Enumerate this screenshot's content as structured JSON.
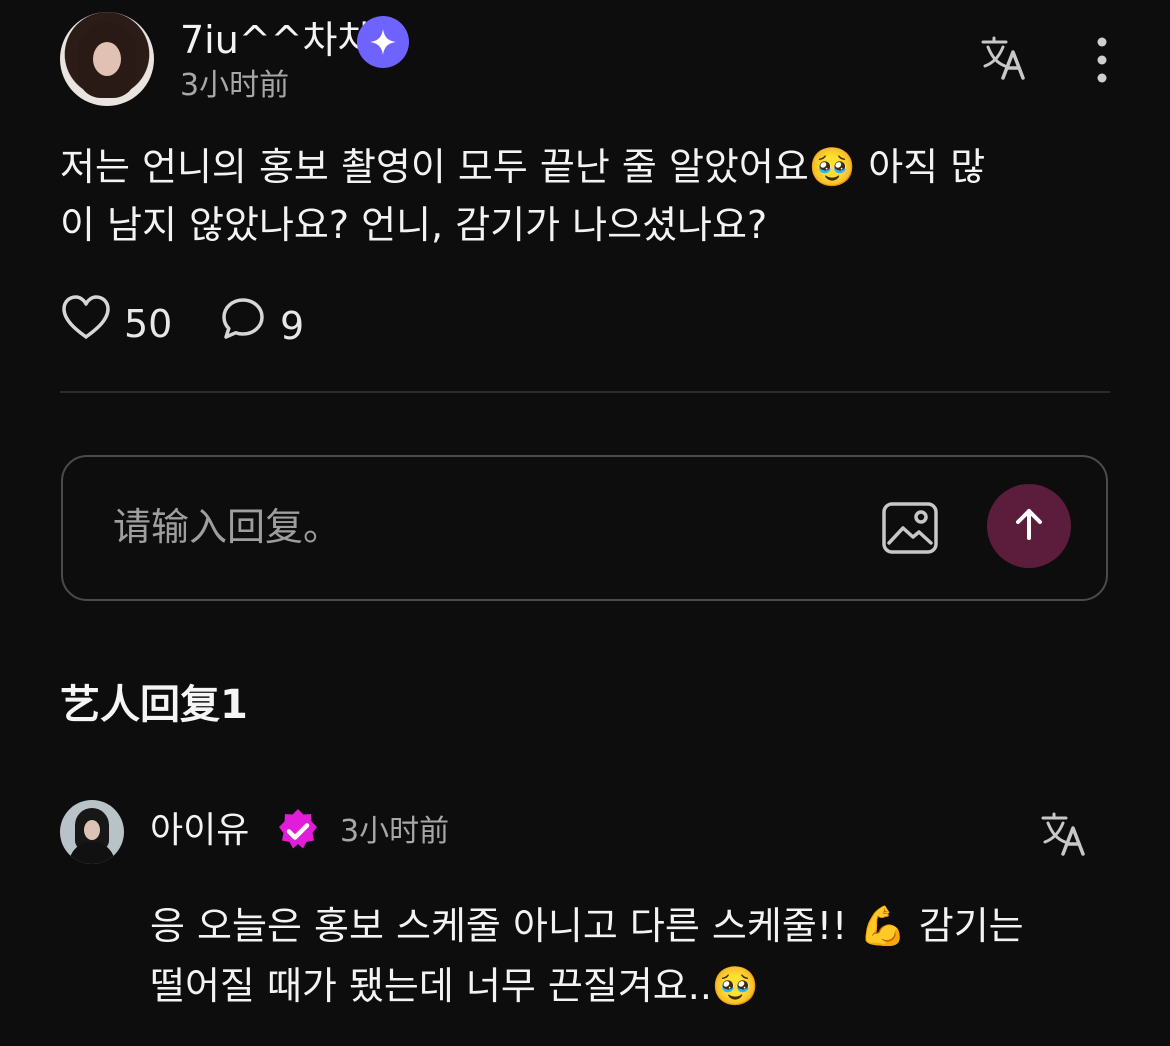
{
  "post": {
    "author_name": "7iu^^차차",
    "time": "3小时前",
    "text": "저는 언니의 홍보 촬영이 모두 끝난 줄 알았어요🥹 아직 많\n이 남지 않았나요? 언니, 감기가 나으셨나요?",
    "likes": "50",
    "comments": "9"
  },
  "reply_box": {
    "placeholder": "请输入回复。"
  },
  "section": {
    "artist_replies_title": "艺人回复1"
  },
  "artist_reply": {
    "name": "아이유",
    "time": "3小时前",
    "text": "응 오늘은 홍보 스케줄 아니고 다른 스케줄!! 💪 감기는\n떨어질 때가 됐는데 너무 끈질겨요..🥹"
  },
  "icons": {
    "verified_star": "sparkle-verified-icon",
    "translate": "translate-icon",
    "more": "more-vertical-icon",
    "heart": "heart-icon",
    "comment": "comment-icon",
    "image": "image-icon",
    "send": "send-arrow-icon",
    "artist_verified": "artist-verified-icon"
  },
  "colors": {
    "background": "#0d0d0d",
    "primary_text": "#f3f3f3",
    "muted_text": "#a7a7a7",
    "purple_badge": "#6f63ff",
    "pink_badge": "#e11dd9",
    "send_button": "#5c1d3d"
  }
}
